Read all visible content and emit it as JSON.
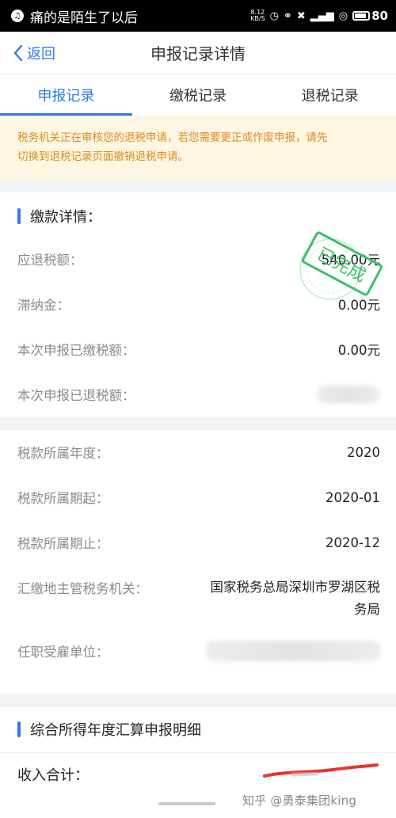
{
  "status_bar": {
    "song": "痛的是陌生了以后",
    "net_speed_value": "8.12",
    "net_speed_unit": "KB/S",
    "battery": "80",
    "icons": [
      "alarm-icon",
      "headset-icon",
      "vibrate-off-icon",
      "signal-icon",
      "hd-icon",
      "battery-icon"
    ]
  },
  "nav": {
    "back_label": "返回",
    "title": "申报记录详情"
  },
  "tabs": [
    {
      "label": "申报记录",
      "active": true
    },
    {
      "label": "缴税记录",
      "active": false
    },
    {
      "label": "退税记录",
      "active": false
    }
  ],
  "notice": {
    "line1": "税务机关正在审核您的退税申请，若您需要更正或作废申报，请先",
    "line2": "切换到退税记录页面撤销退税申请。"
  },
  "payment": {
    "title": "缴款详情：",
    "stamp_text": "已完成",
    "rows": [
      {
        "label": "应退税额：",
        "value": "540.00元"
      },
      {
        "label": "滞纳金：",
        "value": "0.00元"
      },
      {
        "label": "本次申报已缴税额：",
        "value": "0.00元"
      },
      {
        "label": "本次申报已退税额：",
        "value": ""
      }
    ]
  },
  "tax_info": {
    "rows": [
      {
        "label": "税款所属年度：",
        "value": "2020"
      },
      {
        "label": "税款所属期起：",
        "value": "2020-01"
      },
      {
        "label": "税款所属期止：",
        "value": "2020-12"
      }
    ],
    "authority_label": "汇缴地主管税务机关：",
    "authority_line1": "国家税务总局深圳市罗湖区税",
    "authority_line2": "务局",
    "employer_label": "任职受雇单位："
  },
  "annual": {
    "title": "综合所得年度汇算申报明细",
    "income_label": "收入合计："
  },
  "watermark": "知乎 @勇泰集团king",
  "colors": {
    "accent": "#2d7be5",
    "notice_bg": "#fdf6e3",
    "notice_text": "#e0891e",
    "stamp": "#3cbf6a"
  }
}
